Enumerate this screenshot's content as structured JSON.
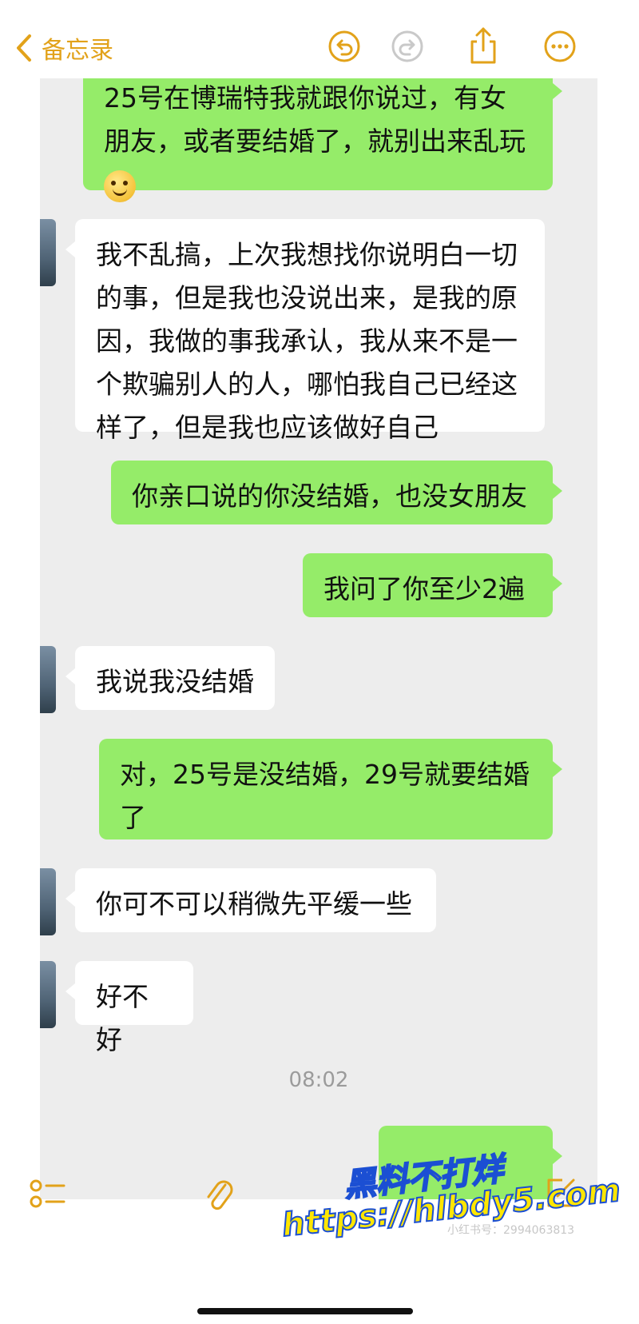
{
  "nav": {
    "back_label": "备忘录"
  },
  "icons": {
    "back": "chevron-left-icon",
    "undo": "undo-icon",
    "redo": "redo-icon",
    "share": "share-icon",
    "more": "more-icon",
    "checklist": "checklist-icon",
    "attach": "paperclip-icon",
    "compose": "compose-icon"
  },
  "colors": {
    "accent": "#e2a21a",
    "sent_bubble": "#95ec69",
    "received_bubble": "#ffffff",
    "chat_bg": "#ededed"
  },
  "messages": [
    {
      "side": "sent",
      "lines": [
        "25号在博瑞特我就跟你说过，有女",
        "朋友，或者要结婚了，就别出来乱玩"
      ],
      "emoji": "smile-emoji"
    },
    {
      "side": "received",
      "lines": [
        "我不乱搞，上次我想找你说明白一切",
        "的事，但是我也没说出来，是我的原",
        "因，我做的事我承认，我从来不是一",
        "个欺骗别人的人，哪怕我自己已经这",
        "样了，但是我也应该做好自己"
      ]
    },
    {
      "side": "sent",
      "lines": [
        "你亲口说的你没结婚，也没女朋友"
      ]
    },
    {
      "side": "sent",
      "lines": [
        "我问了你至少2遍"
      ]
    },
    {
      "side": "received",
      "lines": [
        "我说我没结婚"
      ]
    },
    {
      "side": "sent",
      "lines": [
        "对，25号是没结婚，29号就要结婚",
        "了"
      ]
    },
    {
      "side": "received",
      "lines": [
        "你可不可以稍微先平缓一些"
      ]
    },
    {
      "side": "received",
      "lines": [
        "好不好"
      ]
    }
  ],
  "timestamp": "08:02",
  "watermark": {
    "line1": "黑料不打烊",
    "line2": "https://hlbdy5.com"
  },
  "faint_id": "小红书号：2994063813"
}
